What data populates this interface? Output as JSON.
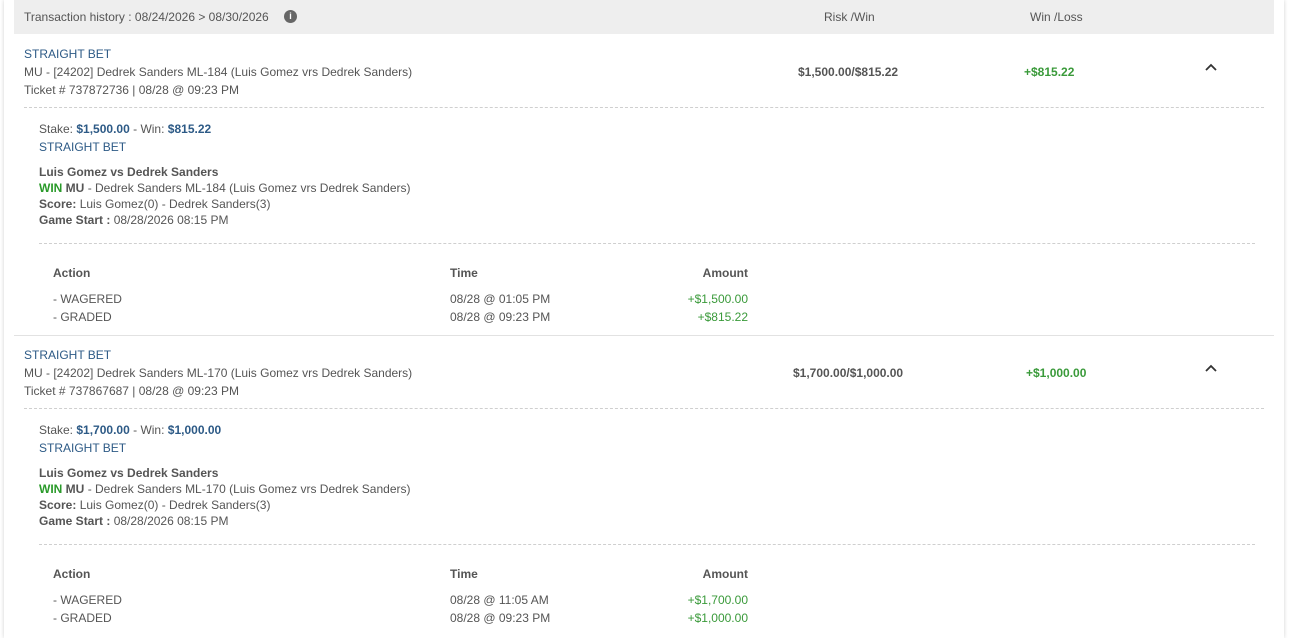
{
  "header": {
    "title": "Transaction history : 08/24/2026 > 08/30/2026",
    "info_icon": "info-icon",
    "col_risk_win": "Risk /Win",
    "col_win_loss": "Win /Loss"
  },
  "bets": [
    {
      "type": "STRAIGHT BET",
      "description": "MU - [24202] Dedrek Sanders ML-184 (Luis Gomez vrs Dedrek Sanders)",
      "ticket": "Ticket # 737872736 | 08/28 @ 09:23 PM",
      "risk_win": "$1,500.00/$815.22",
      "win_loss": "+$815.22",
      "chevron_icon": "chevron-up-icon",
      "detail": {
        "stake_label": "Stake:",
        "stake": "$1,500.00",
        "win_label": "- Win:",
        "win": "$815.22",
        "type": "STRAIGHT BET",
        "match": "Luis Gomez vs Dedrek Sanders",
        "result": "WIN",
        "market": "MU",
        "pick": "-   Dedrek Sanders ML-184 (Luis Gomez vrs Dedrek Sanders)",
        "score_label": "Score:",
        "score": "Luis Gomez(0) - Dedrek Sanders(3)",
        "game_start_label": "Game Start :",
        "game_start": "08/28/2026 08:15 PM"
      },
      "table": {
        "headers": {
          "action": "Action",
          "time": "Time",
          "amount": "Amount"
        },
        "rows": [
          {
            "action": "- WAGERED",
            "time": "08/28 @ 01:05 PM",
            "amount": "+$1,500.00"
          },
          {
            "action": "- GRADED",
            "time": "08/28 @ 09:23 PM",
            "amount": "+$815.22"
          }
        ]
      }
    },
    {
      "type": "STRAIGHT BET",
      "description": "MU - [24202] Dedrek Sanders ML-170 (Luis Gomez vrs Dedrek Sanders)",
      "ticket": "Ticket # 737867687 | 08/28 @ 09:23 PM",
      "risk_win": "$1,700.00/$1,000.00",
      "win_loss": "+$1,000.00",
      "chevron_icon": "chevron-up-icon",
      "detail": {
        "stake_label": "Stake:",
        "stake": "$1,700.00",
        "win_label": "- Win:",
        "win": "$1,000.00",
        "type": "STRAIGHT BET",
        "match": "Luis Gomez vs Dedrek Sanders",
        "result": "WIN",
        "market": "MU",
        "pick": "-   Dedrek Sanders ML-170 (Luis Gomez vrs Dedrek Sanders)",
        "score_label": "Score:",
        "score": "Luis Gomez(0) - Dedrek Sanders(3)",
        "game_start_label": "Game Start :",
        "game_start": "08/28/2026 08:15 PM"
      },
      "table": {
        "headers": {
          "action": "Action",
          "time": "Time",
          "amount": "Amount"
        },
        "rows": [
          {
            "action": "- WAGERED",
            "time": "08/28 @ 11:05 AM",
            "amount": "+$1,700.00"
          },
          {
            "action": "- GRADED",
            "time": "08/28 @ 09:23 PM",
            "amount": "+$1,000.00"
          }
        ]
      }
    }
  ]
}
